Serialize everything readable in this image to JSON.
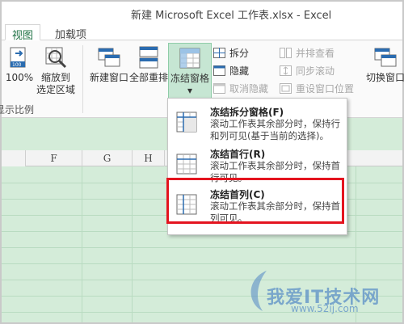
{
  "window": {
    "title": "新建 Microsoft Excel 工作表.xlsx - Excel"
  },
  "tabs": [
    {
      "label": "视图"
    },
    {
      "label": "加载项"
    }
  ],
  "ribbon": {
    "zoom100": "100%",
    "zoom_selection": [
      "缩放到",
      "选定区域"
    ],
    "new_window": "新建窗口",
    "arrange_all": "全部重排",
    "freeze_panes": "冻结窗格",
    "freeze_arrow": "▾",
    "split": "拆分",
    "hide": "隐藏",
    "unhide": "取消隐藏",
    "view_side_by_side": "并排查看",
    "sync_scroll": "同步滚动",
    "reset_window_pos": "重设窗口位置",
    "switch_windows": "切换窗口",
    "group_label_zoom": "显示比例"
  },
  "columns": [
    "F",
    "G",
    "H"
  ],
  "menu": {
    "items": [
      {
        "title": "冻结拆分窗格(F)",
        "desc": "滚动工作表其余部分时，保持行和列可见(基于当前的选择)。"
      },
      {
        "title": "冻结首行(R)",
        "desc": "滚动工作表其余部分时，保持首行可见。"
      },
      {
        "title": "冻结首列(C)",
        "desc": "滚动工作表其余部分时，保持首列可见。"
      }
    ]
  },
  "watermark": {
    "text": "我爱IT技术网",
    "url": "www.52ij.com"
  },
  "colors": {
    "excel_green": "#217346",
    "sheet_green": "#d4ecd9",
    "highlight_red": "#e4141f"
  }
}
